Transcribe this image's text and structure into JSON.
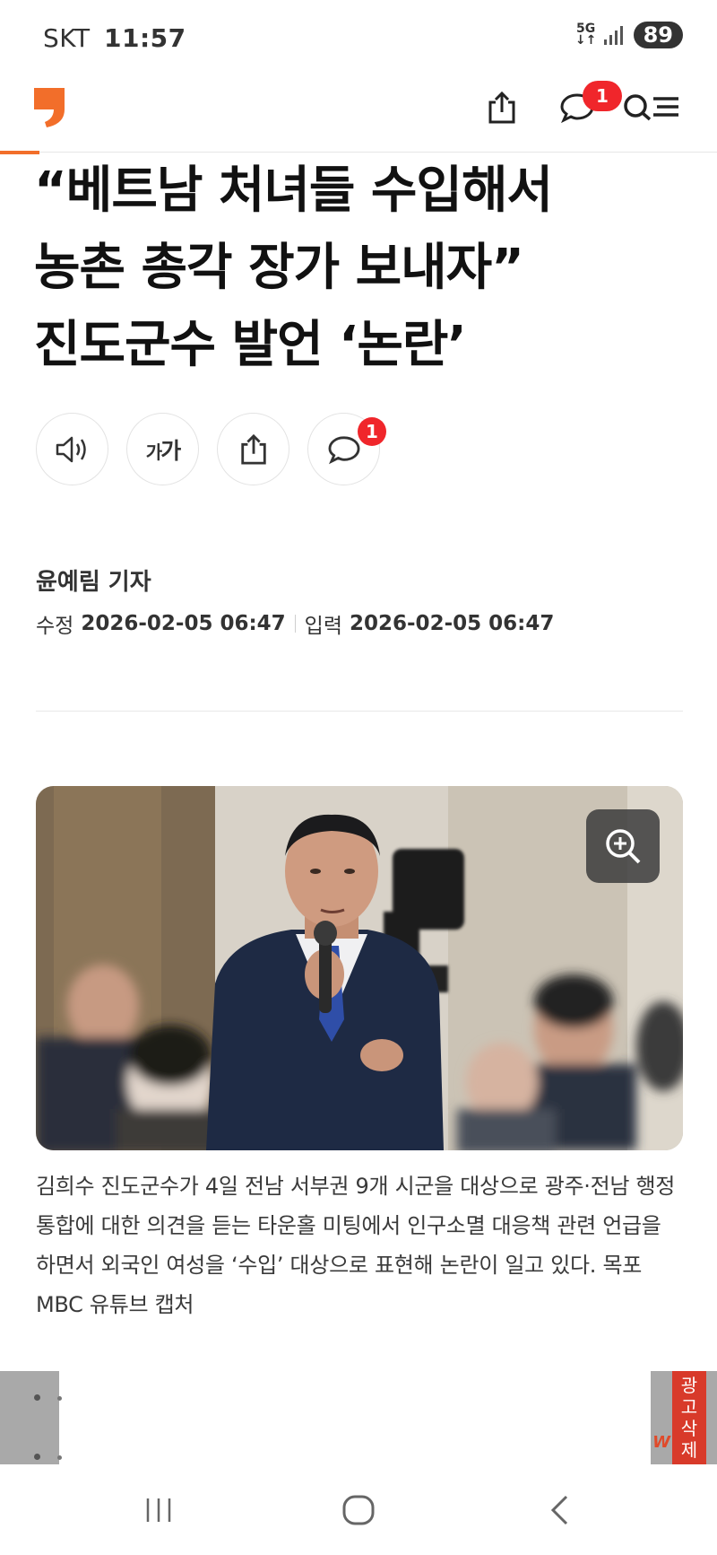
{
  "status_bar": {
    "carrier": "SKT",
    "time": "11:57",
    "network_label_top": "5G",
    "network_label_bottom": "↓↑",
    "battery": "89"
  },
  "header": {
    "comment_badge": "1",
    "accent_color": "#f26e2a"
  },
  "article": {
    "reading_progress": 0.055,
    "title_lines": [
      "“베트남 처녀들 수입해서",
      "농촌 총각 장가 보내자”",
      "진도군수 발언 ‘논란’"
    ],
    "tools": {
      "font_size_label_small": "가",
      "font_size_label_large": "가",
      "comment_badge": "1"
    },
    "author": "윤예림 기자",
    "modified_label": "수정",
    "modified_date": "2026-02-05 06:47",
    "input_label": "입력",
    "input_date": "2026-02-05 06:47",
    "photo": {
      "caption": "김희수 진도군수가 4일 전남 서부권 9개 시군을 대상으로 광주·전남 행정통합에 대한 의견을 듣는 타운홀 미팅에서 인구소멸 대응책 관련 언급을 하면서 외국인 여성을 ‘수입’ 대상으로 표현해 논란이 일고 있다. 목포MBC 유튜브 캡처"
    }
  },
  "ad": {
    "remove_chars": [
      "광",
      "고",
      "삭",
      "제"
    ]
  },
  "icons": {
    "share": "share-icon",
    "comment": "comment-icon",
    "search_menu": "search-menu-icon",
    "speaker": "speaker-icon",
    "zoom": "zoom-in-icon",
    "recents": "recents-icon",
    "home": "home-icon",
    "back": "back-icon"
  }
}
